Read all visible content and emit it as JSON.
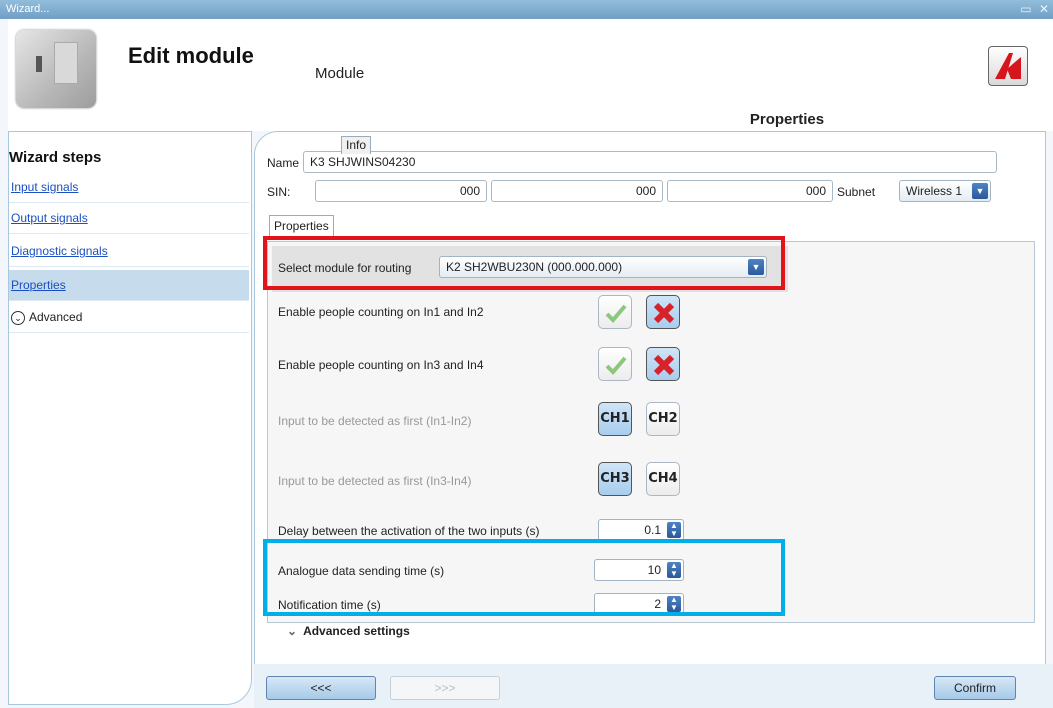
{
  "window": {
    "title": "Wizard..."
  },
  "header": {
    "title": "Edit module",
    "subtitle": "Module",
    "tab": "Properties"
  },
  "sidebar": {
    "title": "Wizard steps",
    "items": [
      {
        "label": "Input signals"
      },
      {
        "label": "Output signals"
      },
      {
        "label": "Diagnostic signals"
      },
      {
        "label": "Properties",
        "active": true
      }
    ],
    "advanced": "Advanced"
  },
  "form": {
    "name_label": "Name",
    "name_value": "K3 SHJWINS04230",
    "sin_label": "SIN:",
    "sin_values": [
      "000",
      "000",
      "000"
    ],
    "subnet_label": "Subnet",
    "subnet_value": "Wireless 1",
    "tabs": [
      "Properties",
      "Info"
    ]
  },
  "properties": {
    "routing_label": "Select module for routing",
    "routing_value": "K2 SH2WBU230N (000.000.000)",
    "people12_label": "Enable people counting on In1 and In2",
    "people34_label": "Enable people counting on In3 and In4",
    "first12_label": "Input to be detected as first (In1-In2)",
    "first34_label": "Input to be detected as first (In3-In4)",
    "ch": [
      "CH1",
      "CH2",
      "CH3",
      "CH4"
    ],
    "delay_label": "Delay between the activation of the two inputs (s)",
    "delay_value": "0.1",
    "analogue_label": "Analogue data sending time (s)",
    "analogue_value": "10",
    "notification_label": "Notification time (s)",
    "notification_value": "2",
    "advanced_settings": "Advanced settings"
  },
  "footer": {
    "back": "<<<",
    "next": ">>>",
    "confirm": "Confirm"
  },
  "colors": {
    "red_highlight": "#e2141b",
    "blue_highlight": "#00aee8",
    "link": "#1a4fc1"
  }
}
